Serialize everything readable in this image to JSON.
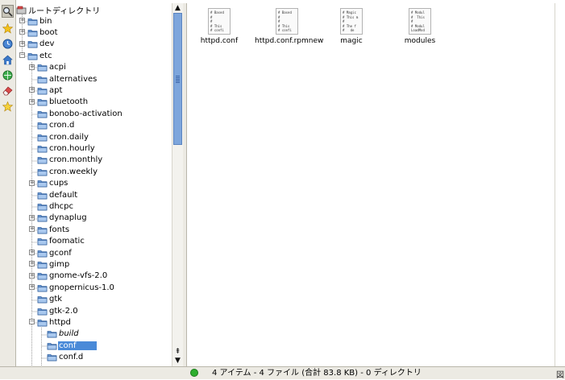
{
  "tree": {
    "root_label": "ルートディレクトリ",
    "items": [
      {
        "label": "bin",
        "expander": "+"
      },
      {
        "label": "boot",
        "expander": "+"
      },
      {
        "label": "dev",
        "expander": "+"
      },
      {
        "label": "etc",
        "expander": "-"
      },
      {
        "label": "acpi",
        "expander": "+"
      },
      {
        "label": "alternatives",
        "expander": ""
      },
      {
        "label": "apt",
        "expander": "+"
      },
      {
        "label": "bluetooth",
        "expander": "+"
      },
      {
        "label": "bonobo-activation",
        "expander": ""
      },
      {
        "label": "cron.d",
        "expander": ""
      },
      {
        "label": "cron.daily",
        "expander": ""
      },
      {
        "label": "cron.hourly",
        "expander": ""
      },
      {
        "label": "cron.monthly",
        "expander": ""
      },
      {
        "label": "cron.weekly",
        "expander": ""
      },
      {
        "label": "cups",
        "expander": "+"
      },
      {
        "label": "default",
        "expander": ""
      },
      {
        "label": "dhcpc",
        "expander": ""
      },
      {
        "label": "dynaplug",
        "expander": "+"
      },
      {
        "label": "fonts",
        "expander": "+"
      },
      {
        "label": "foomatic",
        "expander": ""
      },
      {
        "label": "gconf",
        "expander": "+"
      },
      {
        "label": "gimp",
        "expander": "+"
      },
      {
        "label": "gnome-vfs-2.0",
        "expander": "+"
      },
      {
        "label": "gnopernicus-1.0",
        "expander": "+"
      },
      {
        "label": "gtk",
        "expander": ""
      },
      {
        "label": "gtk-2.0",
        "expander": ""
      },
      {
        "label": "httpd",
        "expander": "-"
      },
      {
        "label": "build",
        "expander": ""
      },
      {
        "label": "conf",
        "expander": ""
      },
      {
        "label": "conf.d",
        "expander": ""
      }
    ]
  },
  "files": [
    {
      "name": "httpd.conf",
      "preview": [
        "# Based",
        "#",
        "#",
        "# This",
        "# confi"
      ]
    },
    {
      "name": "httpd.conf.rpmnew",
      "preview": [
        "# Based",
        "#",
        "#",
        "# This",
        "# confi"
      ]
    },
    {
      "name": "magic",
      "preview": [
        "# Magic",
        "# This m",
        "#",
        "# The f",
        "#   de"
      ]
    },
    {
      "name": "modules",
      "preview": [
        "# Modul",
        "#  This",
        "#",
        "# Modul",
        "LoadMod"
      ]
    }
  ],
  "status": {
    "text": "4 アイテム - 4 ファイル (合計 83.8 KB) - 0 ディレクトリ",
    "right_glyph": "図"
  },
  "sidebar_icons": [
    "search-icon",
    "bookmark-star-icon",
    "history-clock-icon",
    "home-icon",
    "network-icon",
    "eraser-icon",
    "favorite-star-icon"
  ],
  "colors": {
    "selection": "#4a8ad8",
    "folder_blue": "#6f9fd8",
    "scroll_thumb": "#7ea6dc",
    "status_green": "#2eae2e"
  }
}
